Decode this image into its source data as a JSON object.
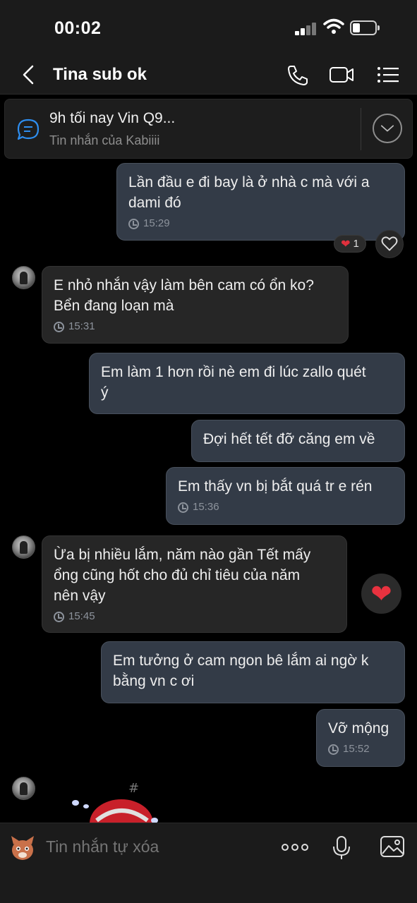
{
  "status_bar": {
    "time": "00:02"
  },
  "header": {
    "title": "Tina sub ok"
  },
  "pinned": {
    "title": "9h tối nay Vin Q9...",
    "subtitle": "Tin nhắn của Kabiiii"
  },
  "messages": [
    {
      "dir": "out",
      "text": "Lần đầu e đi bay là ở nhà c mà với a\ndami đó",
      "time": "15:29"
    },
    {
      "dir": "in",
      "text": "E nhỏ nhắn vậy làm bên cam có ổn ko?\nBển đang loạn mà",
      "time": "15:31"
    },
    {
      "dir": "out",
      "text": "Em làm 1 hơn rồi nè em đi lúc zallo quét\ný",
      "time": ""
    },
    {
      "dir": "out",
      "text": "Đợi hết tết đỡ căng em về",
      "time": ""
    },
    {
      "dir": "out",
      "text": "Em thấy vn bị bắt quá tr e rén",
      "time": "15:36"
    },
    {
      "dir": "in",
      "text": "Ừa bị nhiều lắm, năm nào gần Tết mấy\nổng cũng hốt cho đủ chỉ tiêu của năm\nnên vậy",
      "time": "15:45"
    },
    {
      "dir": "out",
      "text": "Em tưởng ở cam ngon bê lắm ai ngờ k\nbằng vn c ơi",
      "time": ""
    },
    {
      "dir": "out",
      "text": "Vỡ mộng",
      "time": "15:52"
    }
  ],
  "reactions": {
    "heart_count": "1",
    "heart_glyph": "❤"
  },
  "composer": {
    "placeholder": "Tin nhắn tự xóa"
  },
  "colors": {
    "outgoing_bubble": "#333b47",
    "incoming_bubble": "#262626",
    "background": "#000000",
    "heart": "#e0303d"
  }
}
